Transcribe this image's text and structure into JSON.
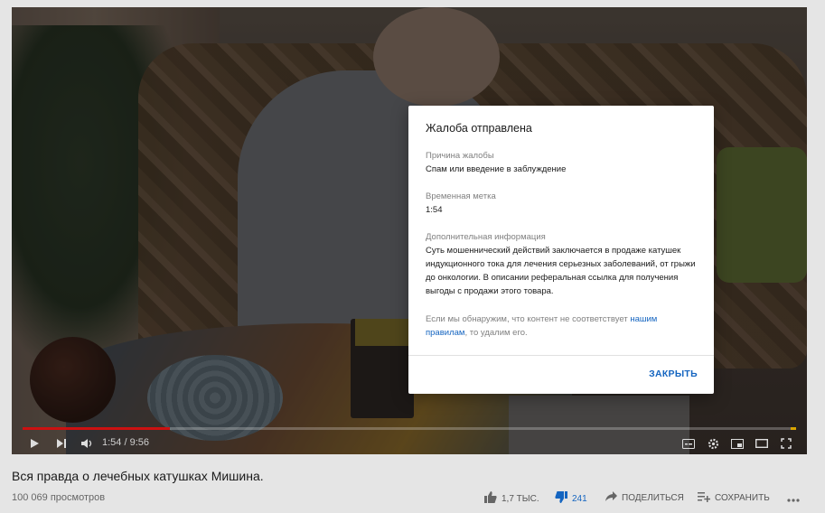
{
  "player": {
    "time_current": "1:54",
    "time_separator": "/",
    "time_total": "9:56",
    "progress": 0.19
  },
  "modal": {
    "title": "Жалоба отправлена",
    "reason_label": "Причина жалобы",
    "reason_value": "Спам или введение в заблуждение",
    "timestamp_label": "Временная метка",
    "timestamp_value": "1:54",
    "details_label": "Дополнительная информация",
    "details_value": "Суть мошеннический действий заключается в продаже катушек индукционного тока для лечения серьезных заболеваний, от грыжи до онкологии. В описании реферальная ссылка для получения выгоды с продажи этого товара.",
    "notice_prefix": "Если мы обнаружим, что контент не соответствует",
    "notice_link": "нашим правилам",
    "notice_suffix": ", то удалим его.",
    "close_label": "ЗАКРЫТЬ"
  },
  "video": {
    "title": "Вся правда о лечебных катушках Мишина.",
    "views": "100 069 просмотров",
    "likes": "1,7 ТЫС.",
    "dislikes": "241",
    "share_label": "ПОДЕЛИТЬСЯ",
    "save_label": "СОХРАНИТЬ"
  },
  "colors": {
    "accent_blue": "#1565c0",
    "progress_red": "#cc1111"
  },
  "icons": [
    "play-icon",
    "next-icon",
    "volume-icon",
    "subtitles-icon",
    "settings-icon",
    "miniplayer-icon",
    "theater-icon",
    "fullscreen-icon",
    "like-icon",
    "dislike-icon",
    "share-icon",
    "save-icon",
    "more-icon"
  ]
}
